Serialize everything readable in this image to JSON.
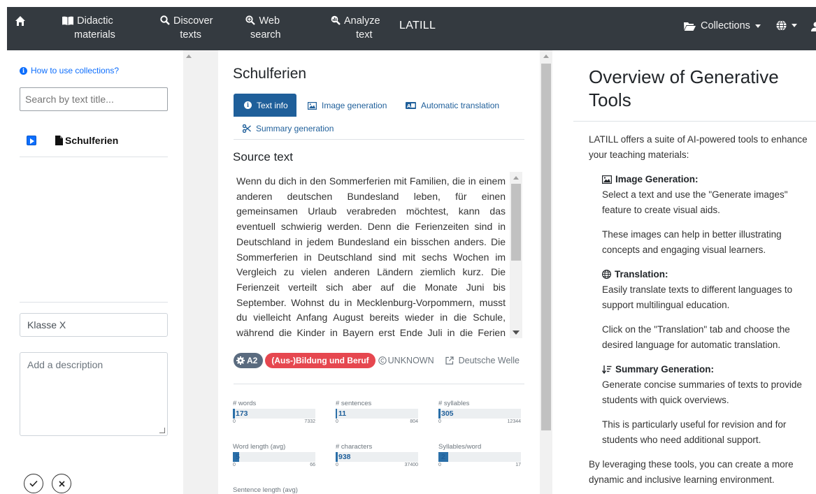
{
  "nav": {
    "brand": "LATILL",
    "items": [
      {
        "line1": "Didactic",
        "line2": "materials"
      },
      {
        "line1": "Discover",
        "line2": "texts"
      },
      {
        "line1": "Web",
        "line2": "search"
      },
      {
        "line1": "Analyze",
        "line2": "text"
      }
    ],
    "collections_label": "Collections"
  },
  "left": {
    "how_to": "How to use collections?",
    "search_placeholder": "Search by text title...",
    "collection_title": "Schulferien",
    "name_value": "Klasse X",
    "description_placeholder": "Add a description"
  },
  "middle": {
    "title": "Schulferien",
    "tabs": {
      "text_info": "Text info",
      "image_generation": "Image generation",
      "automatic_translation": "Automatic translation",
      "summary_generation": "Summary generation"
    },
    "source_heading": "Source text",
    "source_text": "Wenn du dich in den Sommerferien mit Familien, die in einem anderen deutschen Bundesland leben, für einen gemeinsamen Urlaub verabreden möchtest, kann das eventuell schwierig werden. Denn die Ferienzeiten sind in Deutschland in jedem Bundesland ein bisschen anders. Die Sommerferien in Deutschland sind mit sechs Wochen im Vergleich zu vielen anderen Ländern ziemlich kurz. Die Ferienzeit verteilt sich aber auf die Monate Juni bis September. Wohnst du in Mecklenburg-Vorpommern, musst du vielleicht Anfang August bereits wieder in die Schule, während die Kinder in Bayern erst Ende Juli in die Ferien gehen.",
    "level": "A2",
    "topic": "(Aus-)Bildung und Beruf",
    "license": "UNKNOWN",
    "source": "Deutsche Welle",
    "stats": [
      {
        "label": "# words",
        "value": "173",
        "min": "0",
        "max": "7332",
        "fraction": 0.024
      },
      {
        "label": "# sentences",
        "value": "11",
        "min": "0",
        "max": "804",
        "fraction": 0.014
      },
      {
        "label": "# syllables",
        "value": "305",
        "min": "0",
        "max": "12344",
        "fraction": 0.025
      },
      {
        "label": "Word length (avg)",
        "value": "5",
        "min": "0",
        "max": "66",
        "fraction": 0.076
      },
      {
        "label": "# characters",
        "value": "938",
        "min": "0",
        "max": "37400",
        "fraction": 0.025
      },
      {
        "label": "Syllables/word",
        "value": "2",
        "min": "0",
        "max": "17",
        "fraction": 0.118
      }
    ],
    "sentence_length_label": "Sentence length (avg)"
  },
  "right": {
    "title": "Overview of Generative Tools",
    "intro": "LATILL offers a suite of AI-powered tools to enhance your teaching materials:",
    "image_h": "Image Generation:",
    "image_p1": "Select a text and use the \"Generate images\" feature to create visual aids.",
    "image_p2": "These images can help in better illustrating concepts and engaging visual learners.",
    "trans_h": "Translation:",
    "trans_p1": "Easily translate texts to different languages to support multilingual education.",
    "trans_p2": "Click on the \"Translation\" tab and choose the desired language for automatic translation.",
    "sum_h": "Summary Generation:",
    "sum_p1": "Generate concise summaries of texts to provide students with quick overviews.",
    "sum_p2": "This is particularly useful for revision and for students who need additional support.",
    "outro": "By leveraging these tools, you can create a more dynamic and inclusive learning environment."
  }
}
